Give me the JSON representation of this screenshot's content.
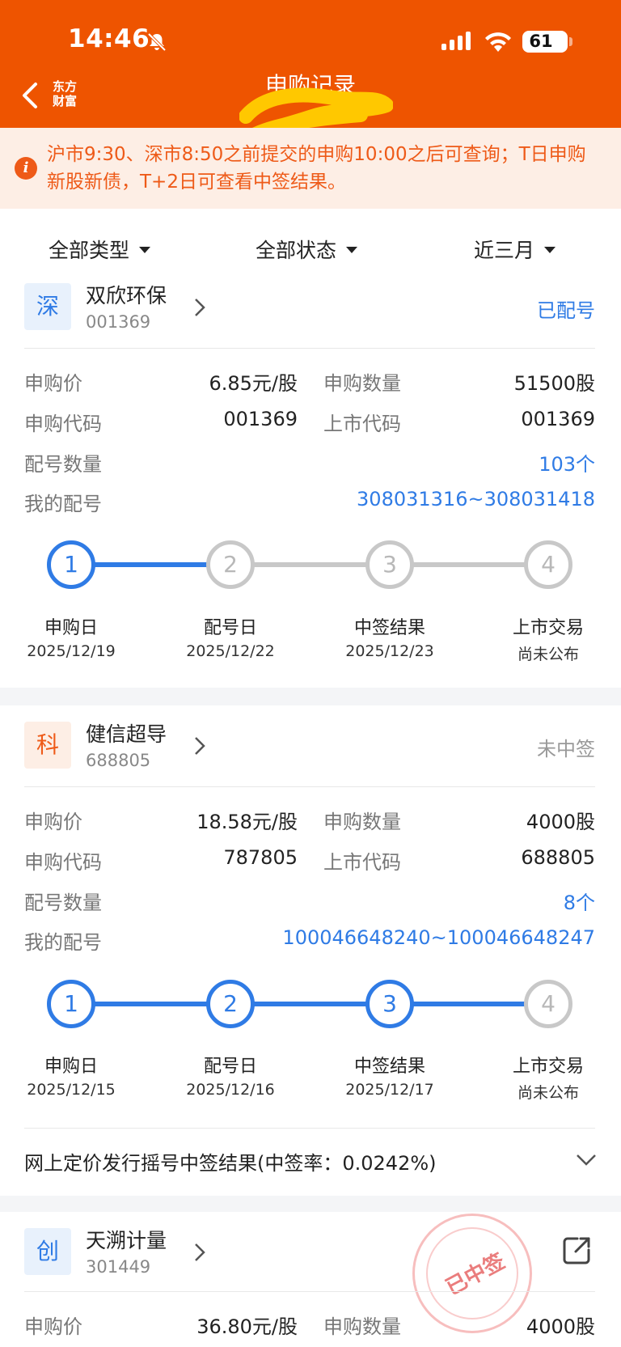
{
  "status_bar": {
    "time": "14:46",
    "battery": "61"
  },
  "header": {
    "title": "申购记录",
    "logo_line1": "东方",
    "logo_line2": "财富"
  },
  "notice": {
    "text": "沪市9:30、深市8:50之前提交的申购10:00之后可查询；T日申购新股新债，T+2日可查看中签结果。"
  },
  "filters": {
    "type": "全部类型",
    "status": "全部状态",
    "period": "近三月"
  },
  "labels": {
    "price": "申购价",
    "quantity": "申购数量",
    "sub_code": "申购代码",
    "list_code": "上市代码",
    "alloc_count": "配号数量",
    "my_alloc": "我的配号"
  },
  "records": [
    {
      "market": "深",
      "name": "双欣环保",
      "code": "001369",
      "status": "已配号",
      "price": "6.85元/股",
      "quantity": "51500股",
      "sub_code": "001369",
      "list_code": "001369",
      "alloc_count": "103个",
      "my_alloc": "308031316~308031418",
      "steps": [
        {
          "num": "1",
          "label": "申购日",
          "date": "2025/12/19"
        },
        {
          "num": "2",
          "label": "配号日",
          "date": "2025/12/22"
        },
        {
          "num": "3",
          "label": "中签结果",
          "date": "2025/12/23"
        },
        {
          "num": "4",
          "label": "上市交易",
          "date": "尚未公布"
        }
      ]
    },
    {
      "market": "科",
      "name": "健信超导",
      "code": "688805",
      "status": "未中签",
      "price": "18.58元/股",
      "quantity": "4000股",
      "sub_code": "787805",
      "list_code": "688805",
      "alloc_count": "8个",
      "my_alloc": "100046648240~100046648247",
      "steps": [
        {
          "num": "1",
          "label": "申购日",
          "date": "2025/12/15"
        },
        {
          "num": "2",
          "label": "配号日",
          "date": "2025/12/16"
        },
        {
          "num": "3",
          "label": "中签结果",
          "date": "2025/12/17"
        },
        {
          "num": "4",
          "label": "上市交易",
          "date": "尚未公布"
        }
      ],
      "result": "网上定价发行摇号中签结果(中签率：0.0242%)"
    },
    {
      "market": "创",
      "name": "天溯计量",
      "code": "301449",
      "stamp": "已中签",
      "price": "36.80元/股",
      "quantity": "4000股"
    }
  ],
  "colors": {
    "brand": "#ee5400",
    "accent_blue": "#2f7be5",
    "notice_text": "#ee5a18"
  }
}
